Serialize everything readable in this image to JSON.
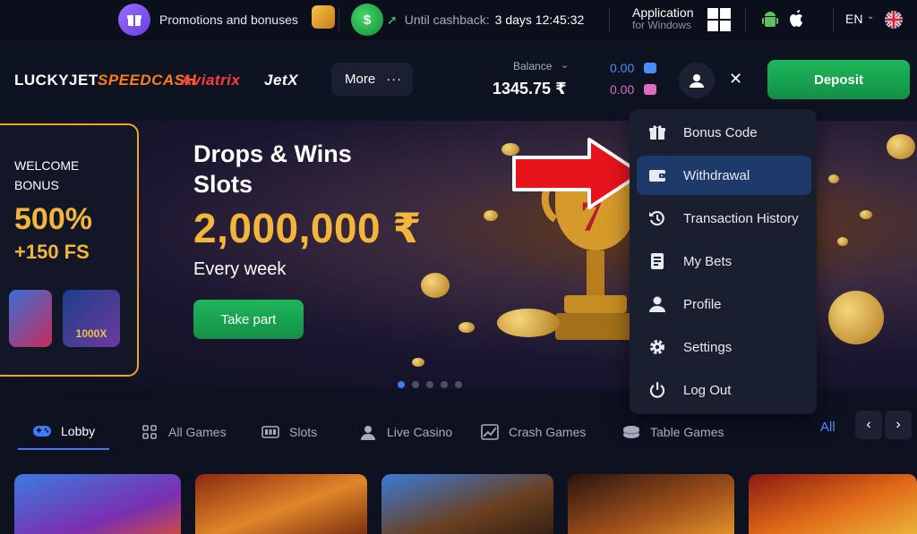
{
  "topbar": {
    "promo_label": "Promotions and bonuses",
    "cashback_label": "Until cashback:",
    "cashback_time": "3 days 12:45:32",
    "cash_icon_text": "$",
    "app_title": "Application",
    "app_subtitle": "for Windows",
    "language": "EN",
    "icons": [
      "gift-icon",
      "cashback-icon",
      "windows-icon",
      "android-icon",
      "apple-icon",
      "uk-flag-icon"
    ]
  },
  "navbar": {
    "logos": [
      "LUCKYJET",
      "SPEEDCASH",
      "Aviatrix",
      "JetX"
    ],
    "more_label": "More",
    "more_dots": "···",
    "balance_label": "Balance",
    "balance_value": "1345.75 ₹",
    "bonus_balance_1": "0.00",
    "bonus_balance_2": "0.00",
    "close_label": "✕",
    "deposit_label": "Deposit"
  },
  "welcome": {
    "title": "WELCOME BONUS",
    "percent": "500%",
    "free_spins": "+150 FS",
    "thumb_label": "1000X"
  },
  "banner": {
    "title": "Drops & Wins Slots",
    "prize": "2,000,000 ₹",
    "subtitle": "Every week",
    "button_label": "Take part",
    "slide_count": 5,
    "active_slide": 1,
    "trophy_text": "7"
  },
  "menu": {
    "items": [
      {
        "label": "Bonus Code",
        "icon": "gift-icon"
      },
      {
        "label": "Withdrawal",
        "icon": "wallet-icon",
        "active": true
      },
      {
        "label": "Transaction History",
        "icon": "history-icon"
      },
      {
        "label": "My Bets",
        "icon": "receipt-icon"
      },
      {
        "label": "Profile",
        "icon": "user-icon"
      },
      {
        "label": "Settings",
        "icon": "gear-icon"
      },
      {
        "label": "Log Out",
        "icon": "power-icon"
      }
    ]
  },
  "tabs": {
    "items": [
      {
        "label": "Lobby",
        "icon": "gamepad-icon",
        "active": true
      },
      {
        "label": "All Games",
        "icon": "grid-icon"
      },
      {
        "label": "Slots",
        "icon": "slot-icon"
      },
      {
        "label": "Live Casino",
        "icon": "dealer-icon"
      },
      {
        "label": "Crash Games",
        "icon": "crash-icon"
      },
      {
        "label": "Table Games",
        "icon": "chips-icon"
      }
    ],
    "all_label": "All",
    "prev_label": "‹",
    "next_label": "›"
  },
  "colors": {
    "accent_green": "#1fb65a",
    "accent_gold": "#f3b53a",
    "accent_blue": "#3f7bf5",
    "background": "#0d1120"
  }
}
